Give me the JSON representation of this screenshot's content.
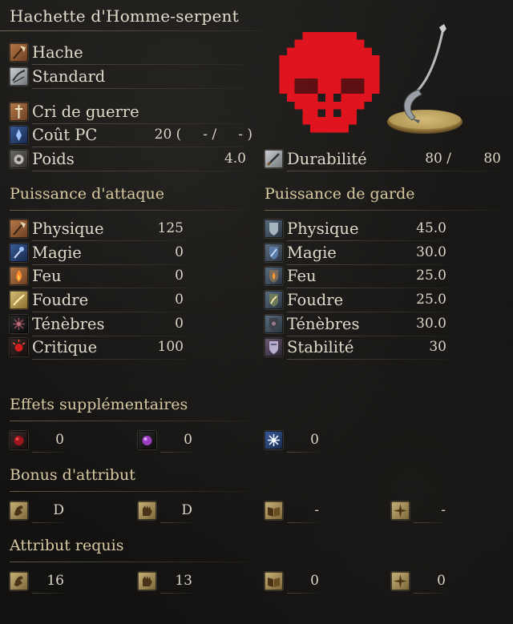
{
  "weapon": {
    "name": "Hachette d'Homme-serpent",
    "type": "Hache",
    "attack_type": "Standard",
    "skill": "Cri de guerre",
    "fp_label": "Coût PC",
    "fp_cost": "20 (     - /     - )",
    "weight_label": "Poids",
    "weight": "4.0",
    "durability_label": "Durabilité",
    "durability_current": "80 /",
    "durability_max": "80"
  },
  "attack": {
    "title": "Puissance d'attaque",
    "rows": [
      {
        "label": "Physique",
        "value": "125",
        "icon": "axe-icon"
      },
      {
        "label": "Magie",
        "value": "0",
        "icon": "magic-icon"
      },
      {
        "label": "Feu",
        "value": "0",
        "icon": "fire-icon"
      },
      {
        "label": "Foudre",
        "value": "0",
        "icon": "lightning-icon"
      },
      {
        "label": "Ténèbres",
        "value": "0",
        "icon": "dark-icon"
      },
      {
        "label": "Critique",
        "value": "100",
        "icon": "critical-icon"
      }
    ]
  },
  "guard": {
    "title": "Puissance de garde",
    "rows": [
      {
        "label": "Physique",
        "value": "45.0",
        "icon": "shield-physical-icon"
      },
      {
        "label": "Magie",
        "value": "30.0",
        "icon": "shield-magic-icon"
      },
      {
        "label": "Feu",
        "value": "25.0",
        "icon": "shield-fire-icon"
      },
      {
        "label": "Foudre",
        "value": "25.0",
        "icon": "shield-lightning-icon"
      },
      {
        "label": "Ténèbres",
        "value": "30.0",
        "icon": "shield-dark-icon"
      },
      {
        "label": "Stabilité",
        "value": "30",
        "icon": "stability-icon"
      }
    ]
  },
  "effects": {
    "title": "Effets supplémentaires",
    "values": [
      "0",
      "0",
      "0"
    ],
    "icons": [
      "bleed-icon",
      "poison-icon",
      "frost-icon"
    ]
  },
  "bonus": {
    "title": "Bonus d'attribut",
    "values": [
      "D",
      "D",
      "-",
      "-"
    ],
    "icons": [
      "strength-icon",
      "dexterity-icon",
      "intelligence-icon",
      "faith-icon"
    ]
  },
  "requirements": {
    "title": "Attribut requis",
    "values": [
      "16",
      "13",
      "0",
      "0"
    ],
    "icons": [
      "strength-icon",
      "dexterity-icon",
      "intelligence-icon",
      "faith-icon"
    ]
  },
  "colors": {
    "skull": "#e0141e",
    "accent_text": "#d7c9a1"
  }
}
